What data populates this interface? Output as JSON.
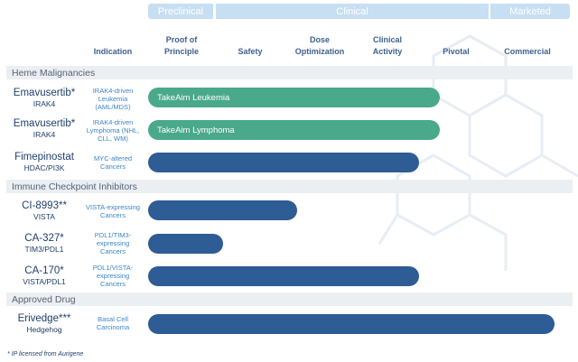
{
  "phases": {
    "preclinical": "Preclinical",
    "clinical": "Clinical",
    "marketed": "Marketed"
  },
  "columns": {
    "indication": "Indication",
    "proof": "Proof of Principle",
    "safety": "Safety",
    "dose": "Dose Optimization",
    "activity": "Clinical Activity",
    "pivotal": "Pivotal",
    "commercial": "Commercial"
  },
  "categories": {
    "heme": "Heme Malignancies",
    "immune": "Immune Checkpoint Inhibitors",
    "approved": "Approved Drug"
  },
  "colors": {
    "teal": "#4aa98a",
    "blue": "#2e5c95",
    "phase": "#c7dff2"
  },
  "chart_data": {
    "type": "bar",
    "stage_scale": [
      "Proof of Principle",
      "Safety",
      "Dose Optimization",
      "Clinical Activity",
      "Pivotal",
      "Commercial"
    ],
    "rows": [
      {
        "drug": "Emavusertib*",
        "target": "IRAK4",
        "indication": "IRAK4-driven Leukemia (AML/MDS)",
        "bar_label": "TakeAim Leukemia",
        "color": "teal",
        "progress": 4.3
      },
      {
        "drug": "Emavusertib*",
        "target": "IRAK4",
        "indication": "IRAK4-driven Lymphoma (NHL, CLL, WM)",
        "bar_label": "TakeAim Lymphoma",
        "color": "teal",
        "progress": 4.3
      },
      {
        "drug": "Fimepinostat",
        "target": "HDAC/PI3K",
        "indication": "MYC-altered Cancers",
        "bar_label": "",
        "color": "blue",
        "progress": 4.0
      },
      {
        "drug": "CI-8993**",
        "target": "VISTA",
        "indication": "VISTA-expressing Cancers",
        "bar_label": "",
        "color": "blue",
        "progress": 2.2
      },
      {
        "drug": "CA-327*",
        "target": "TIM3/PDL1",
        "indication": "PDL1/TIM3-expressing Cancers",
        "bar_label": "",
        "color": "blue",
        "progress": 1.1
      },
      {
        "drug": "CA-170*",
        "target": "VISTA/PDL1",
        "indication": "PDL1/VISTA-expressing Cancers",
        "bar_label": "",
        "color": "blue",
        "progress": 4.0
      },
      {
        "drug": "Erivedge***",
        "target": "Hedgehog",
        "indication": "Basal Cell Carcinoma",
        "bar_label": "",
        "color": "blue",
        "progress": 6.0
      }
    ]
  },
  "footnote": "* IP licensed from Aurigene"
}
